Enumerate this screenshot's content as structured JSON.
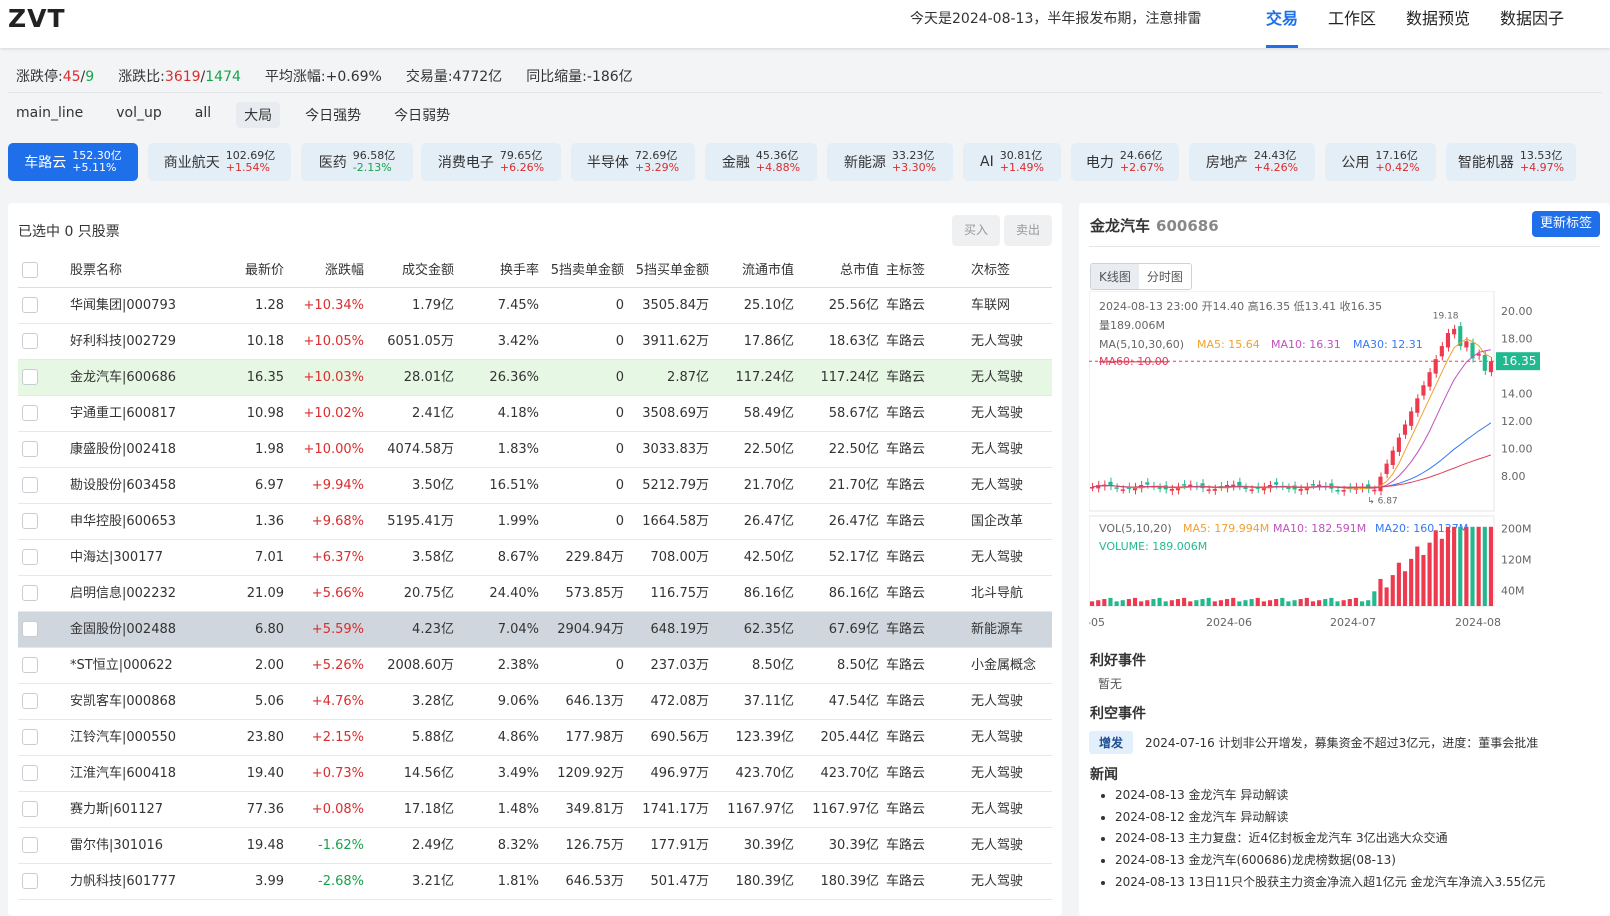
{
  "header": {
    "logo": "ZVT",
    "notice": "今天是2024-08-13，半年报发布期，注意排雷",
    "nav": [
      "交易",
      "工作区",
      "数据预览",
      "数据因子"
    ]
  },
  "stats": {
    "limit_label": "涨跌停:",
    "limit_up": "45",
    "limit_down": "9",
    "ratio_label": "涨跌比:",
    "ratio_up": "3619",
    "ratio_down": "1474",
    "avg_change": "平均涨幅:+0.69%",
    "volume": "交易量:4772亿",
    "volume_change": "同比缩量:-186亿"
  },
  "filters": [
    "main_line",
    "vol_up",
    "all",
    "大局",
    "今日强势",
    "今日弱势"
  ],
  "sectors": [
    {
      "name": "车路云",
      "amount": "152.30亿",
      "pct": "+5.11%"
    },
    {
      "name": "商业航天",
      "amount": "102.69亿",
      "pct": "+1.54%"
    },
    {
      "name": "医药",
      "amount": "96.58亿",
      "pct": "-2.13%"
    },
    {
      "name": "消费电子",
      "amount": "79.65亿",
      "pct": "+6.26%"
    },
    {
      "name": "半导体",
      "amount": "72.69亿",
      "pct": "+3.29%"
    },
    {
      "name": "金融",
      "amount": "45.36亿",
      "pct": "+4.88%"
    },
    {
      "name": "新能源",
      "amount": "33.23亿",
      "pct": "+3.30%"
    },
    {
      "name": "AI",
      "amount": "30.81亿",
      "pct": "+1.49%"
    },
    {
      "name": "电力",
      "amount": "24.66亿",
      "pct": "+2.67%"
    },
    {
      "name": "房地产",
      "amount": "24.43亿",
      "pct": "+4.26%"
    },
    {
      "name": "公用",
      "amount": "17.16亿",
      "pct": "+0.42%"
    },
    {
      "name": "智能机器",
      "amount": "13.53亿",
      "pct": "+4.97%"
    }
  ],
  "table": {
    "selected_info": "已选中 0 只股票",
    "buy": "买入",
    "sell": "卖出",
    "columns": [
      "股票名称",
      "最新价",
      "涨跌幅",
      "成交金额",
      "换手率",
      "5挡卖单金额",
      "5挡买单金额",
      "流通市值",
      "总市值",
      "主标签",
      "次标签"
    ],
    "rows": [
      [
        "华闻集团|000793",
        "1.28",
        "+10.34%",
        "1.79亿",
        "7.45%",
        "0",
        "3505.84万",
        "25.10亿",
        "25.56亿",
        "车路云",
        "车联网"
      ],
      [
        "好利科技|002729",
        "10.18",
        "+10.05%",
        "6051.05万",
        "3.42%",
        "0",
        "3911.62万",
        "17.86亿",
        "18.63亿",
        "车路云",
        "无人驾驶"
      ],
      [
        "金龙汽车|600686",
        "16.35",
        "+10.03%",
        "28.01亿",
        "26.36%",
        "0",
        "2.87亿",
        "117.24亿",
        "117.24亿",
        "车路云",
        "无人驾驶"
      ],
      [
        "宇通重工|600817",
        "10.98",
        "+10.02%",
        "2.41亿",
        "4.18%",
        "0",
        "3508.69万",
        "58.49亿",
        "58.67亿",
        "车路云",
        "无人驾驶"
      ],
      [
        "康盛股份|002418",
        "1.98",
        "+10.00%",
        "4074.58万",
        "1.83%",
        "0",
        "3033.83万",
        "22.50亿",
        "22.50亿",
        "车路云",
        "无人驾驶"
      ],
      [
        "勘设股份|603458",
        "6.97",
        "+9.94%",
        "3.50亿",
        "16.51%",
        "0",
        "5212.79万",
        "21.70亿",
        "21.70亿",
        "车路云",
        "无人驾驶"
      ],
      [
        "申华控股|600653",
        "1.36",
        "+9.68%",
        "5195.41万",
        "1.99%",
        "0",
        "1664.58万",
        "26.47亿",
        "26.47亿",
        "车路云",
        "国企改革"
      ],
      [
        "中海达|300177",
        "7.01",
        "+6.37%",
        "3.58亿",
        "8.67%",
        "229.84万",
        "708.00万",
        "42.50亿",
        "52.17亿",
        "车路云",
        "无人驾驶"
      ],
      [
        "启明信息|002232",
        "21.09",
        "+5.66%",
        "20.75亿",
        "24.40%",
        "573.85万",
        "116.75万",
        "86.16亿",
        "86.16亿",
        "车路云",
        "北斗导航"
      ],
      [
        "金固股份|002488",
        "6.80",
        "+5.59%",
        "4.23亿",
        "7.04%",
        "2904.94万",
        "648.19万",
        "62.35亿",
        "67.69亿",
        "车路云",
        "新能源车"
      ],
      [
        "*ST恒立|000622",
        "2.00",
        "+5.26%",
        "2008.60万",
        "2.38%",
        "0",
        "237.03万",
        "8.50亿",
        "8.50亿",
        "车路云",
        "小金属概念"
      ],
      [
        "安凯客车|000868",
        "5.06",
        "+4.76%",
        "3.28亿",
        "9.06%",
        "646.13万",
        "472.08万",
        "37.11亿",
        "47.54亿",
        "车路云",
        "无人驾驶"
      ],
      [
        "江铃汽车|000550",
        "23.80",
        "+2.15%",
        "5.88亿",
        "4.86%",
        "177.98万",
        "690.56万",
        "123.39亿",
        "205.44亿",
        "车路云",
        "无人驾驶"
      ],
      [
        "江淮汽车|600418",
        "19.40",
        "+0.73%",
        "14.56亿",
        "3.49%",
        "1209.92万",
        "496.97万",
        "423.70亿",
        "423.70亿",
        "车路云",
        "无人驾驶"
      ],
      [
        "赛力斯|601127",
        "77.36",
        "+0.08%",
        "17.18亿",
        "1.48%",
        "349.81万",
        "1741.17万",
        "1167.97亿",
        "1167.97亿",
        "车路云",
        "无人驾驶"
      ],
      [
        "雷尔伟|301016",
        "19.48",
        "-1.62%",
        "2.49亿",
        "8.32%",
        "126.75万",
        "177.91万",
        "30.39亿",
        "30.39亿",
        "车路云",
        "无人驾驶"
      ],
      [
        "力帆科技|601777",
        "3.99",
        "-2.68%",
        "3.21亿",
        "1.81%",
        "646.53万",
        "501.47万",
        "180.39亿",
        "180.39亿",
        "车路云",
        "无人驾驶"
      ]
    ]
  },
  "detail": {
    "name": "金龙汽车",
    "code": "600686",
    "update_btn": "更新标签",
    "tabs": [
      "K线图",
      "分时图"
    ],
    "kline": {
      "info_line": "2024-08-13 23:00   开14.40   高16.35   低13.41   收16.35",
      "volume_line": "量189.006M",
      "ma_label": "MA(5,10,30,60)",
      "ma5": "MA5: 15.64",
      "ma10": "MA10: 16.31",
      "ma30": "MA30: 12.31",
      "ma60": "MA60: 10.00",
      "price_axis": [
        "20.00",
        "18.00",
        "16.00",
        "14.00",
        "12.00",
        "10.00",
        "8.00"
      ],
      "last_price": "16.35",
      "high_mark": "19.18",
      "low_mark": "6.87",
      "vol_label": "VOL(5,10,20)",
      "vol_ma5": "MA5: 179.994M",
      "vol_ma10": "MA10: 182.591M",
      "vol_ma20": "MA20: 160.127M",
      "vol_value": "VOLUME: 189.006M",
      "vol_axis": [
        "200M",
        "120M",
        "40M"
      ],
      "dates": [
        "-05",
        "2024-06",
        "2024-07",
        "2024-08"
      ],
      "colors": {
        "up": "#ee3a4e",
        "down": "#23b98f",
        "ma5": "#f0a030",
        "ma10": "#c050c0",
        "ma30": "#3478f6",
        "ma60": "#e04060"
      }
    },
    "good_events_title": "利好事件",
    "good_events_none": "暂无",
    "bad_events_title": "利空事件",
    "bad_event": {
      "tag": "增发",
      "text": "2024-07-16 计划非公开增发，募集资金不超过3亿元，进度：董事会批准"
    },
    "news_title": "新闻",
    "news": [
      "2024-08-13 金龙汽车 异动解读",
      "2024-08-12 金龙汽车 异动解读",
      "2024-08-13 主力复盘：近4亿封板金龙汽车 3亿出逃大众交通",
      "2024-08-13 金龙汽车(600686)龙虎榜数据(08-13)",
      "2024-08-13 13日11只个股获主力资金净流入超1亿元 金龙汽车净流入3.55亿元"
    ]
  }
}
